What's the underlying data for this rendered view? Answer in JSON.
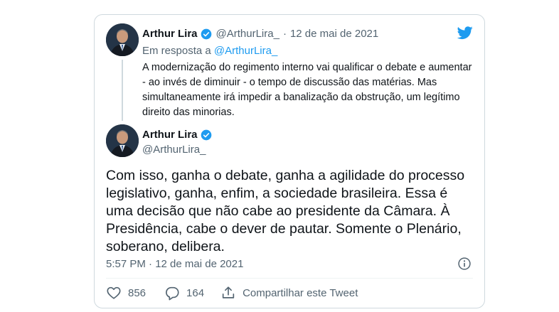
{
  "colors": {
    "brand_blue": "#1d9bf0",
    "text_primary": "#0f1419",
    "text_muted": "#536471",
    "border": "#cfd9de"
  },
  "quoted_tweet": {
    "author_name": "Arthur Lira",
    "handle": "@ArthurLira_",
    "separator": "·",
    "date": "12 de mai de 2021",
    "reply_prefix": "Em resposta a",
    "reply_to": "@ArthurLira_",
    "text": "A modernização do regimento interno vai qualificar o debate e aumentar - ao invés de diminuir - o tempo de discussão das matérias. Mas simultaneamente irá impedir a banalização da obstrução, um legítimo direito das minorias."
  },
  "main_tweet": {
    "author_name": "Arthur Lira",
    "handle": "@ArthurLira_",
    "text": "Com isso, ganha o debate, ganha a agilidade do processo legislativo, ganha, enfim, a sociedade brasileira. Essa é uma decisão que não cabe ao presidente da Câmara. À Presidência, cabe o dever de pautar. Somente o Plenário, soberano, delibera.",
    "timestamp": "5:57 PM · 12 de mai de 2021"
  },
  "actions": {
    "likes": "856",
    "replies": "164",
    "share_label": "Compartilhar este Tweet"
  },
  "icons": {
    "logo": "twitter-bird-icon",
    "verified": "verified-badge-icon",
    "info": "info-icon",
    "like": "heart-icon",
    "reply": "comment-icon",
    "share": "share-icon"
  }
}
